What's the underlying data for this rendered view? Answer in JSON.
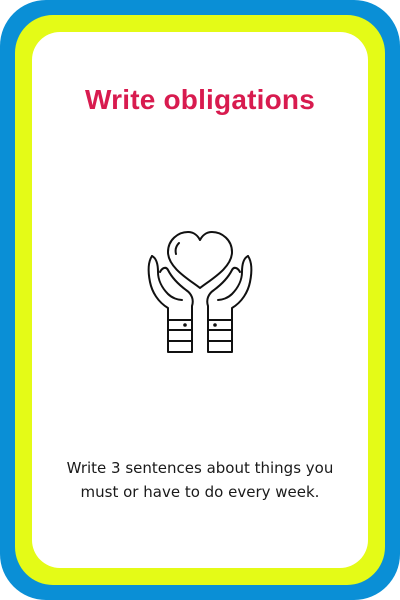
{
  "card": {
    "title": "Write obligations",
    "instructions": "Write 3 sentences about things you must or have to do every week.",
    "icon": "hands-holding-heart-icon",
    "colors": {
      "outer_border": "#0a8fd6",
      "inner_border": "#e4fb17",
      "background": "#ffffff",
      "title": "#d81b4f",
      "text": "#1a1a1a"
    }
  }
}
